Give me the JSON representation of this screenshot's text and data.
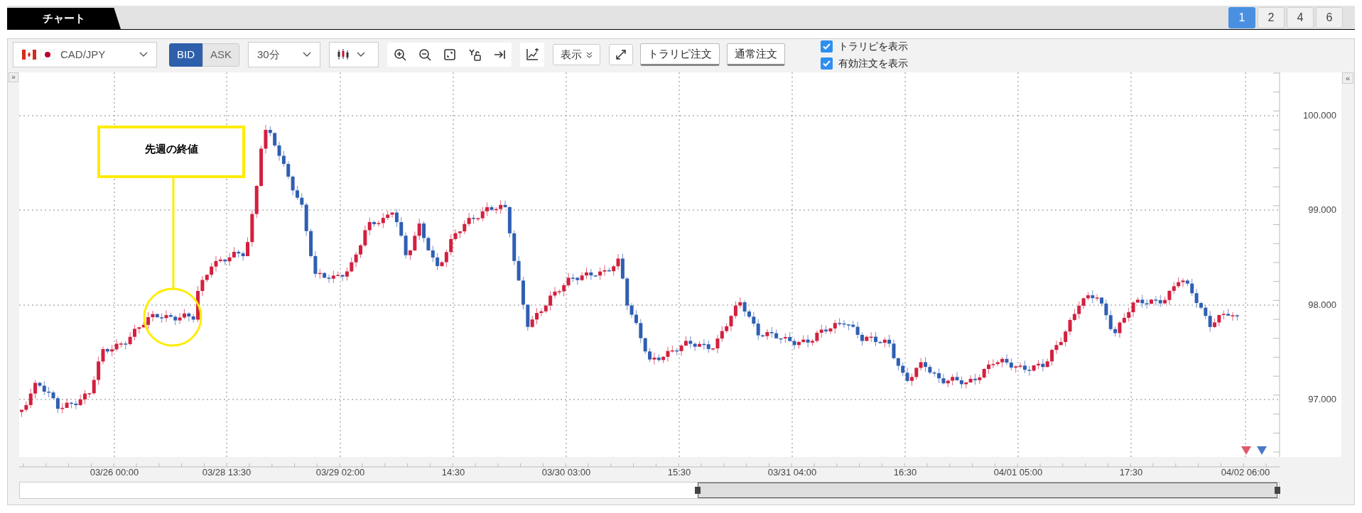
{
  "tab": {
    "label": "チャート"
  },
  "layout_buttons": [
    {
      "label": "1",
      "selected": true
    },
    {
      "label": "2",
      "selected": false
    },
    {
      "label": "4",
      "selected": false
    },
    {
      "label": "6",
      "selected": false
    }
  ],
  "toolbar": {
    "pair": "CAD/JPY",
    "price_side": [
      {
        "label": "BID",
        "selected": true
      },
      {
        "label": "ASK",
        "selected": false
      }
    ],
    "interval": "30分",
    "display_button": "表示",
    "order_buttons": [
      "トラリピ注文",
      "通常注文"
    ],
    "checkboxes": [
      {
        "label": "トラリピを表示",
        "checked": true
      },
      {
        "label": "有効注文を表示",
        "checked": true
      }
    ]
  },
  "chart": {
    "left_toggle": "»",
    "right_toggle": "«",
    "annotation": "先週の終値",
    "y_axis_labels": [
      "100.000",
      "99.000",
      "98.000",
      "97.000"
    ],
    "x_axis_labels": [
      "03/26 00:00",
      "03/28 13:30",
      "03/29 02:00",
      "14:30",
      "03/30 03:00",
      "15:30",
      "03/31 04:00",
      "16:30",
      "04/01 05:00",
      "17:30",
      "04/02 06:00"
    ]
  }
}
